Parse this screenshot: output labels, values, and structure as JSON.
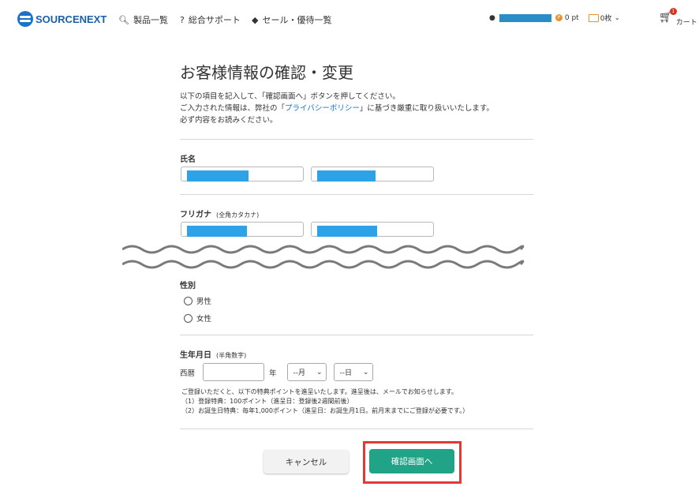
{
  "header": {
    "logo_text": "SOURCENEXT",
    "nav": [
      {
        "icon": "search-icon",
        "label": "製品一覧"
      },
      {
        "icon": "question-icon",
        "label": "総合サポート"
      },
      {
        "icon": "tag-icon",
        "label": "セール・優待一覧"
      }
    ],
    "points": "0 pt",
    "coupons": "0枚",
    "cart_badge": "1",
    "cart_label": "カート"
  },
  "page": {
    "title": "お客様情報の確認・変更",
    "desc_line1": "以下の項目を記入して、「確認画面へ」ボタンを押してください。",
    "desc_line2_pre": "ご入力された情報は、弊社の「",
    "desc_line2_link": "プライバシーポリシー",
    "desc_line2_post": "」に基づき厳重に取り扱いいたします。",
    "desc_line3": "必ず内容をお読みください。"
  },
  "form": {
    "name_label": "氏名",
    "kana_label": "フリガナ",
    "kana_sub": "(全角カタカナ)",
    "gender_label": "性別",
    "gender_options": [
      "男性",
      "女性"
    ],
    "birth_label": "生年月日",
    "birth_sub": "(半角数字)",
    "era": "西暦",
    "year_unit": "年",
    "month_select": "--月",
    "day_select": "--日",
    "note_lines": [
      "ご登録いただくと、以下の特典ポイントを進呈いたします。進呈後は、メールでお知らせします。",
      "（1）登録特典：100ポイント（進呈日：登録後2週間前後）",
      "（2）お誕生日特典：毎年1,000ポイント（進呈日：お誕生月1日。前月末までにご登録が必要です。）"
    ]
  },
  "buttons": {
    "cancel": "キャンセル",
    "confirm": "確認画面へ"
  },
  "colors": {
    "brand": "#1a5fae",
    "accent": "#20a387",
    "highlight": "#e53935",
    "redaction": "#2ea2e6"
  }
}
